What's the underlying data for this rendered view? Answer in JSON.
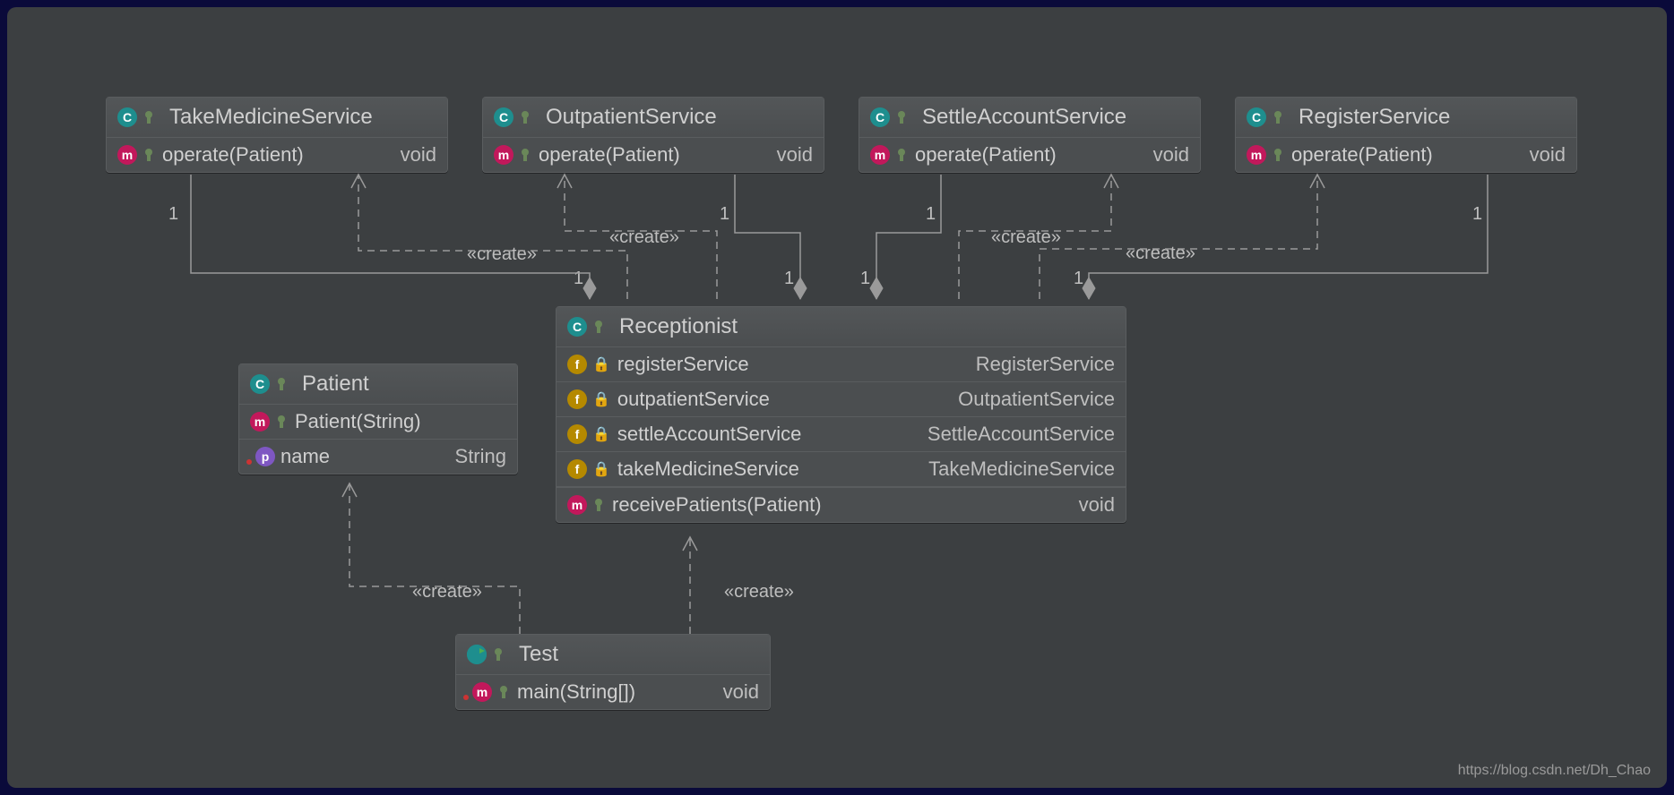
{
  "watermark": "https://blog.csdn.net/Dh_Chao",
  "classes": {
    "takeMedicine": {
      "name": "TakeMedicineService",
      "methods": [
        {
          "sig": "operate(Patient)",
          "ret": "void"
        }
      ]
    },
    "outpatient": {
      "name": "OutpatientService",
      "methods": [
        {
          "sig": "operate(Patient)",
          "ret": "void"
        }
      ]
    },
    "settleAccount": {
      "name": "SettleAccountService",
      "methods": [
        {
          "sig": "operate(Patient)",
          "ret": "void"
        }
      ]
    },
    "register": {
      "name": "RegisterService",
      "methods": [
        {
          "sig": "operate(Patient)",
          "ret": "void"
        }
      ]
    },
    "receptionist": {
      "name": "Receptionist",
      "fields": [
        {
          "name": "registerService",
          "type": "RegisterService"
        },
        {
          "name": "outpatientService",
          "type": "OutpatientService"
        },
        {
          "name": "settleAccountService",
          "type": "SettleAccountService"
        },
        {
          "name": "takeMedicineService",
          "type": "TakeMedicineService"
        }
      ],
      "methods": [
        {
          "sig": "receivePatients(Patient)",
          "ret": "void"
        }
      ]
    },
    "patient": {
      "name": "Patient",
      "constructors": [
        {
          "sig": "Patient(String)"
        }
      ],
      "props": [
        {
          "name": "name",
          "type": "String"
        }
      ]
    },
    "test": {
      "name": "Test",
      "methods": [
        {
          "sig": "main(String[])",
          "ret": "void"
        }
      ]
    }
  },
  "labels": {
    "create": "«create»",
    "one": "1"
  }
}
